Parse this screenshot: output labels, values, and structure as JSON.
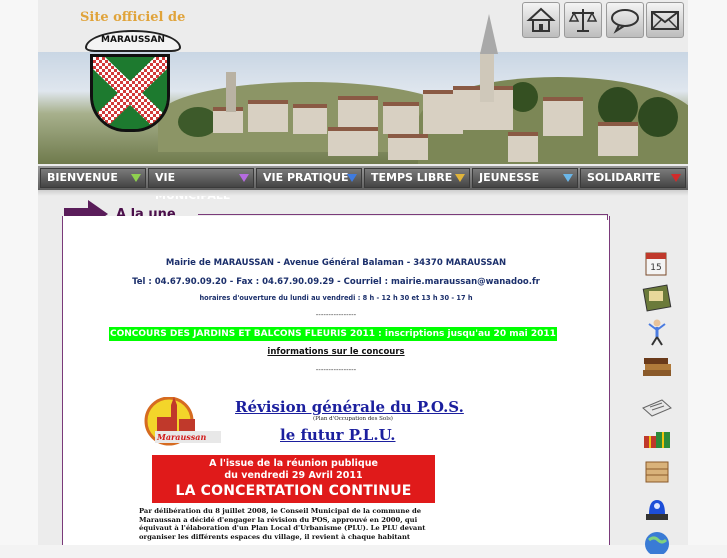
{
  "header": {
    "site_title": "Site officiel de",
    "logo_text": "MARAUSSAN"
  },
  "top_icons": [
    {
      "name": "home-icon"
    },
    {
      "name": "scales-icon"
    },
    {
      "name": "speech-bubble-icon"
    },
    {
      "name": "envelope-icon"
    }
  ],
  "menu": [
    {
      "label": "BIENVENUE",
      "color": "#8fd14f"
    },
    {
      "label": "VIE MUNICIPALE",
      "color": "#b56be0"
    },
    {
      "label": "VIE PRATIQUE",
      "color": "#3f7be0"
    },
    {
      "label": "TEMPS LIBRE",
      "color": "#e0b43a"
    },
    {
      "label": "JEUNESSE",
      "color": "#6bb6e8"
    },
    {
      "label": "SOLIDARITE",
      "color": "#d22b2b"
    }
  ],
  "content": {
    "heading": "A la une",
    "address": "Mairie de MARAUSSAN - Avenue Général Balaman - 34370 MARAUSSAN",
    "contact": "Tel : 04.67.90.09.20 - Fax : 04.67.90.09.29 - Courriel : mairie.maraussan@wanadoo.fr",
    "hours": "horaires d'ouverture du lundi au vendredi : 8 h - 12 h 30 et 13 h 30 - 17 h",
    "separator": "----------------",
    "concours": "CONCOURS DES JARDINS ET BALCONS FLEURIS 2011 : inscriptions jusqu'au 20 mai 2011",
    "info_link": "informations sur le concours",
    "separator2": "----------------"
  },
  "doc": {
    "logo_text": "Maraussan",
    "title1": "Révision générale du P.O.S.",
    "subtitle": "(Plan d'Occupation des Sols)",
    "title2": "le futur  P.L.U.",
    "red_line1": "A l'issue de la réunion publique",
    "red_line2": "du vendredi 29 Avril 2011",
    "red_line3": "LA  CONCERTATION  CONTINUE",
    "paragraph": "Par délibération du 8 juillet 2008, le Conseil Municipal de la commune de Maraussan a décidé d'engager la révision du POS, approuvé en 2000, qui équivaut à l'élaboration d'un Plan Local d'Urbanisme (PLU).",
    "paragraph2": "Le PLU devant organiser les différents espaces du village, il revient à chaque habitant"
  },
  "side_icons": [
    {
      "name": "calendar-icon"
    },
    {
      "name": "notebook-icon"
    },
    {
      "name": "person-icon"
    },
    {
      "name": "books-icon"
    },
    {
      "name": "newspaper-icon"
    },
    {
      "name": "gifts-icon"
    },
    {
      "name": "bread-icon"
    },
    {
      "name": "siren-icon"
    },
    {
      "name": "globe-icon"
    }
  ]
}
